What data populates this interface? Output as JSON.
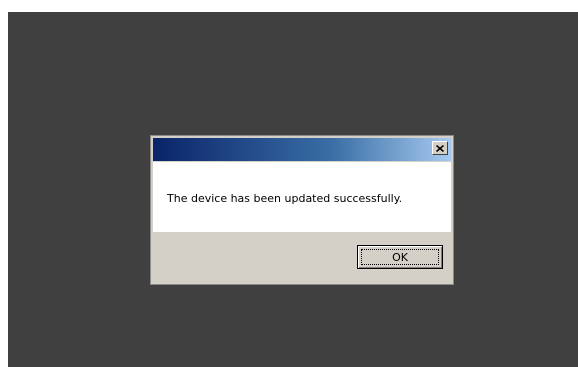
{
  "dialog": {
    "title": "",
    "message": "The device has been updated successfully.",
    "ok_label": "OK",
    "close_icon": "close-icon"
  },
  "colors": {
    "backdrop": "#404040",
    "titlebar_start": "#0a246a",
    "titlebar_end": "#a6caf0",
    "dialog_face": "#d4d0c8",
    "message_bg": "#ffffff"
  }
}
